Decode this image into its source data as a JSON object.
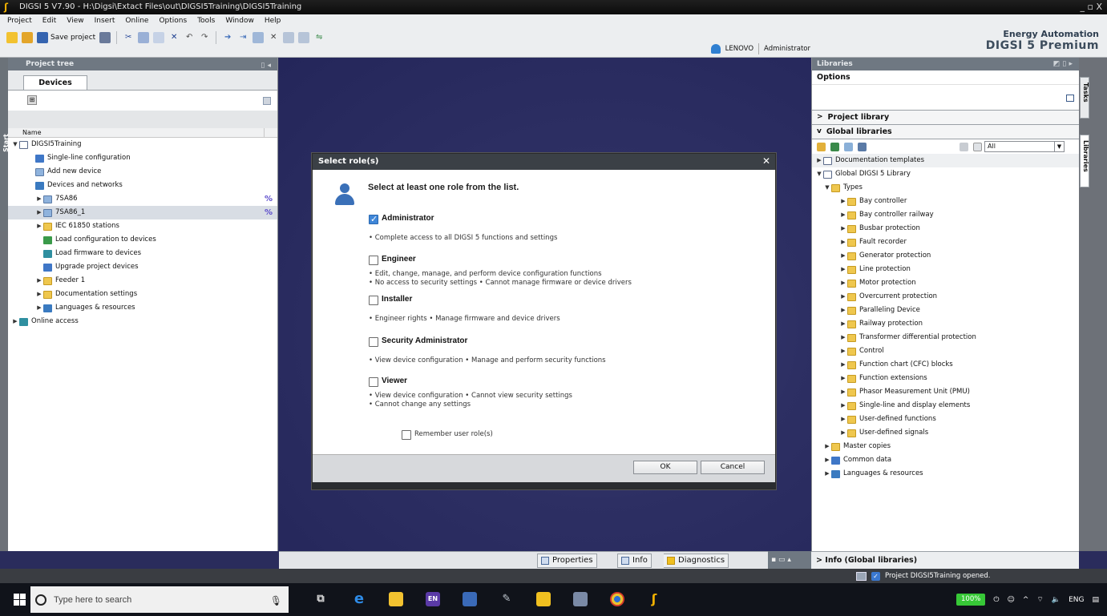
{
  "window": {
    "title": "DIGSI 5 V7.90 - H:\\Digsi\\Extact Files\\out\\DIGSI5Training\\DIGSI5Training",
    "controls": "_ ▫ X"
  },
  "menu": [
    "Project",
    "Edit",
    "View",
    "Insert",
    "Online",
    "Options",
    "Tools",
    "Window",
    "Help"
  ],
  "toolbar": {
    "save_label": "Save project"
  },
  "user": {
    "machine": "LENOVO",
    "account": "Administrator"
  },
  "brand": {
    "line1": "Energy Automation",
    "line2": "DIGSI 5 Premium"
  },
  "left": {
    "strip_label": "Start",
    "panel_title": "Project tree",
    "tab": "Devices",
    "column_header": "Name",
    "tree": [
      {
        "label": "DIGSI5Training"
      },
      {
        "label": "Single-line configuration"
      },
      {
        "label": "Add new device"
      },
      {
        "label": "Devices and networks"
      },
      {
        "label": "7SA86"
      },
      {
        "label": "7SA86_1"
      },
      {
        "label": "IEC 61850 stations"
      },
      {
        "label": "Load configuration to devices"
      },
      {
        "label": "Load firmware to devices"
      },
      {
        "label": "Upgrade project devices"
      },
      {
        "label": "Feeder 1"
      },
      {
        "label": "Documentation settings"
      },
      {
        "label": "Languages & resources"
      },
      {
        "label": "Online access"
      }
    ]
  },
  "dialog": {
    "title": "Select role(s)",
    "prompt": "Select at least one role from the list.",
    "roles": [
      {
        "name": "Administrator",
        "checked": true,
        "desc": [
          "• Complete access to all DIGSI 5 functions and settings"
        ]
      },
      {
        "name": "Engineer",
        "checked": false,
        "desc": [
          "• Edit, change, manage, and perform device configuration functions",
          "• No access to security settings • Cannot manage firmware or device drivers"
        ]
      },
      {
        "name": "Installer",
        "checked": false,
        "desc": [
          "• Engineer rights • Manage firmware and device drivers"
        ]
      },
      {
        "name": "Security Administrator",
        "checked": false,
        "desc": [
          "• View device configuration • Manage and perform security functions"
        ]
      },
      {
        "name": "Viewer",
        "checked": false,
        "desc": [
          "• View device configuration • Cannot view security settings",
          "• Cannot change any settings"
        ]
      }
    ],
    "remember": "Remember user role(s)",
    "ok": "OK",
    "cancel": "Cancel"
  },
  "center_tabs": {
    "properties": "Properties",
    "info": "Info",
    "diagnostics": "Diagnostics"
  },
  "right": {
    "panel_title": "Libraries",
    "options": "Options",
    "project_library": "Project library",
    "global_libraries": "Global libraries",
    "filter": "All",
    "items": [
      {
        "label": "Documentation templates"
      },
      {
        "label": "Global DIGSI 5 Library"
      },
      {
        "label": "Types"
      },
      {
        "label": "Bay controller"
      },
      {
        "label": "Bay controller railway"
      },
      {
        "label": "Busbar protection"
      },
      {
        "label": "Fault recorder"
      },
      {
        "label": "Generator protection"
      },
      {
        "label": "Line protection"
      },
      {
        "label": "Motor protection"
      },
      {
        "label": "Overcurrent protection"
      },
      {
        "label": "Paralleling Device"
      },
      {
        "label": "Railway protection"
      },
      {
        "label": "Transformer differential protection"
      },
      {
        "label": "Control"
      },
      {
        "label": "Function chart (CFC) blocks"
      },
      {
        "label": "Function extensions"
      },
      {
        "label": "Phasor Measurement Unit (PMU)"
      },
      {
        "label": "Single-line and display elements"
      },
      {
        "label": "User-defined functions"
      },
      {
        "label": "User-defined signals"
      },
      {
        "label": "Master copies"
      },
      {
        "label": "Common data"
      },
      {
        "label": "Languages & resources"
      }
    ],
    "info_bar": "Info (Global libraries)",
    "side_tabs": [
      "Tasks",
      "Libraries"
    ]
  },
  "status": {
    "message": "Project DIGSI5Training opened."
  },
  "taskbar": {
    "search_placeholder": "Type here to search",
    "battery": "100%",
    "lang": "ENG"
  }
}
